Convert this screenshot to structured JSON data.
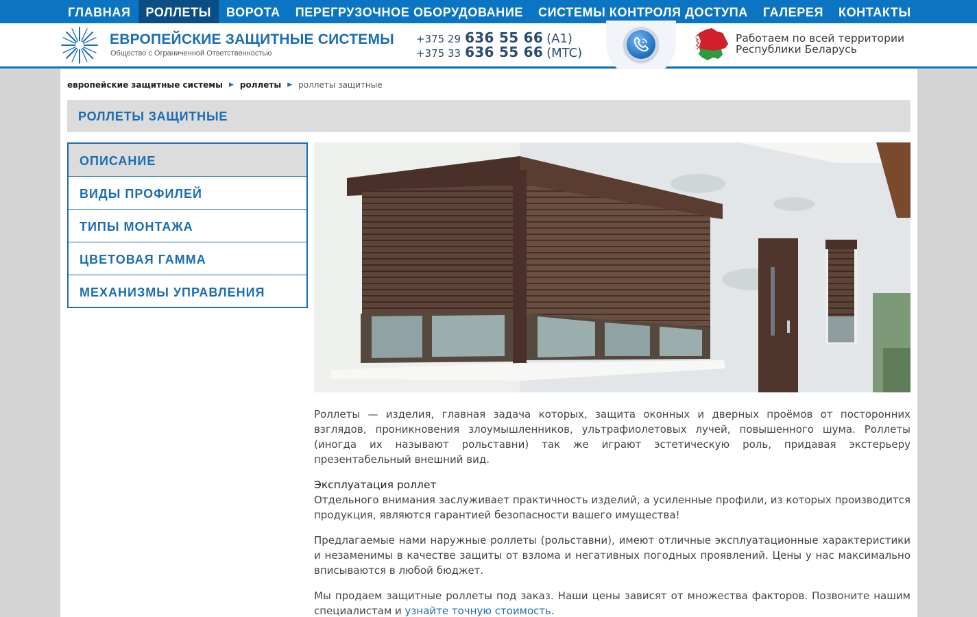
{
  "nav": {
    "items": [
      {
        "label": "ГЛАВНАЯ"
      },
      {
        "label": "РОЛЛЕТЫ"
      },
      {
        "label": "ВОРОТА"
      },
      {
        "label": "ПЕРЕГРУЗОЧНОЕ ОБОРУДОВАНИЕ"
      },
      {
        "label": "СИСТЕМЫ КОНТРОЛЯ ДОСТУПА"
      },
      {
        "label": "ГАЛЕРЕЯ"
      },
      {
        "label": "КОНТАКТЫ"
      }
    ],
    "active_index": 1
  },
  "header": {
    "logo_title": "ЕВРОПЕЙСКИЕ ЗАЩИТНЫЕ СИСТЕМЫ",
    "logo_subtitle": "Общество с Ограниченной Ответственностью",
    "phones": [
      {
        "prefix": "+375 29",
        "number": "636 55 66",
        "operator": "(A1)"
      },
      {
        "prefix": "+375 33",
        "number": "636 55 66",
        "operator": "(MTC)"
      }
    ],
    "call_icon": "phone-icon",
    "map_icon": "belarus-map-icon",
    "region_line1": "Работаем по всей территории",
    "region_line2": "Республики Беларусь"
  },
  "breadcrumb": {
    "home": "европейские защитные системы",
    "section": "роллеты",
    "current": "роллеты защитные"
  },
  "page_title": "РОЛЛЕТЫ ЗАЩИТНЫЕ",
  "sidemenu": {
    "items": [
      {
        "label": "ОПИСАНИЕ"
      },
      {
        "label": "ВИДЫ ПРОФИЛЕЙ"
      },
      {
        "label": "ТИПЫ МОНТАЖА"
      },
      {
        "label": "ЦВЕТОВАЯ ГАММА"
      },
      {
        "label": "МЕХАНИЗМЫ УПРАВЛЕНИЯ"
      }
    ],
    "active_index": 0
  },
  "content": {
    "p1": "Роллеты — изделия, главная задача которых, защита оконных и дверных проёмов от посторонних взглядов, проникновения злоумышленников, ультрафиолетовых лучей, повышенного шума. Роллеты (иногда их называют рольставни) так же играют эстетическую роль, придавая экстерьеру презентабельный внешний вид.",
    "h_exploitation": "Эксплуатация роллет",
    "p2": "Отдельного внимания заслуживает практичность изделий, а усиленные профили, из которых производится продукция, являются гарантией безопасности вашего имущества!",
    "p3": "Предлагаемые нами наружные роллеты (рольставни), имеют отличные эксплуатационные характеристики и незаменимы в качестве защиты от взлома и негативных погодных проявлений. Цены у нас максимально вписываются в любой бюджет.",
    "p4_text": "Мы продаем защитные роллеты под заказ. Наши цены зависят от множества факторов. Позвоните нашим специалистам и ",
    "p4_link": "узнайте точную стоимость",
    "p4_end": "."
  },
  "colors": {
    "brand_blue": "#0b74c3",
    "nav_active": "#0a4e85",
    "accent_text": "#1a6cb4",
    "page_bg": "#d4d4d4",
    "title_bar": "#dcdcdc"
  }
}
